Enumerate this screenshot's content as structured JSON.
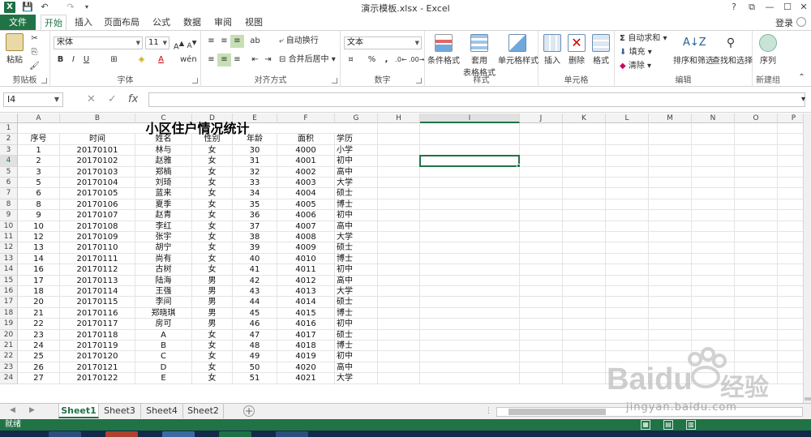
{
  "window": {
    "title": "演示模板.xlsx - Excel",
    "controls": [
      "?",
      "⧉",
      "—",
      "☐",
      "✕"
    ]
  },
  "ribbon_tabs": {
    "file": "文件",
    "tabs": [
      "开始",
      "插入",
      "页面布局",
      "公式",
      "数据",
      "审阅",
      "视图"
    ],
    "active": "开始",
    "login": "登录"
  },
  "ribbon": {
    "clipboard": {
      "label": "剪贴板",
      "paste": "粘贴"
    },
    "font": {
      "label": "字体",
      "font_name": "宋体",
      "font_size": "11"
    },
    "alignment": {
      "label": "对齐方式",
      "wrap": "自动换行",
      "merge": "合并后居中"
    },
    "number": {
      "label": "数字",
      "format": "文本"
    },
    "styles": {
      "label": "样式",
      "conditional": "条件格式",
      "table_1": "套用",
      "table_2": "表格格式",
      "cell_styles": "单元格样式"
    },
    "cells": {
      "label": "单元格",
      "insert": "插入",
      "delete": "删除",
      "format": "格式"
    },
    "editing": {
      "label": "编辑",
      "autosum": "自动求和",
      "fill": "填充",
      "clear": "清除",
      "sort": "排序和筛选",
      "find": "查找和选择"
    },
    "newgroup": {
      "label": "新建组",
      "sequence": "序列"
    }
  },
  "formula_bar": {
    "name_box": "I4",
    "cancel": "✕",
    "enter": "✓",
    "fx": "fx",
    "value": ""
  },
  "grid": {
    "columns": [
      "A",
      "B",
      "C",
      "D",
      "E",
      "F",
      "G",
      "H",
      "I",
      "J",
      "K",
      "L",
      "M",
      "N",
      "O",
      "P"
    ],
    "selected_column": "I",
    "selected_row": "4",
    "row_numbers": [
      "1",
      "2",
      "3",
      "4",
      "5",
      "6",
      "7",
      "8",
      "9",
      "10",
      "11",
      "12",
      "13",
      "14",
      "15",
      "16",
      "17",
      "18",
      "19",
      "20",
      "21",
      "22",
      "23",
      "24"
    ],
    "title": "小区住户情况统计",
    "headers": [
      "序号",
      "时间",
      "姓名",
      "性别",
      "年龄",
      "面积",
      "学历"
    ],
    "rows": [
      [
        "1",
        "20170101",
        "林与",
        "女",
        "30",
        "4000",
        "小学"
      ],
      [
        "2",
        "20170102",
        "赵雅",
        "女",
        "31",
        "4001",
        "初中"
      ],
      [
        "3",
        "20170103",
        "郑楠",
        "女",
        "32",
        "4002",
        "高中"
      ],
      [
        "5",
        "20170104",
        "刘琦",
        "女",
        "33",
        "4003",
        "大学"
      ],
      [
        "6",
        "20170105",
        "蓝来",
        "女",
        "34",
        "4004",
        "硕士"
      ],
      [
        "8",
        "20170106",
        "夏季",
        "女",
        "35",
        "4005",
        "博士"
      ],
      [
        "9",
        "20170107",
        "赵青",
        "女",
        "36",
        "4006",
        "初中"
      ],
      [
        "10",
        "20170108",
        "李红",
        "女",
        "37",
        "4007",
        "高中"
      ],
      [
        "12",
        "20170109",
        "张宇",
        "女",
        "38",
        "4008",
        "大学"
      ],
      [
        "13",
        "20170110",
        "胡宁",
        "女",
        "39",
        "4009",
        "硕士"
      ],
      [
        "14",
        "20170111",
        "尚有",
        "女",
        "40",
        "4010",
        "博士"
      ],
      [
        "16",
        "20170112",
        "古树",
        "女",
        "41",
        "4011",
        "初中"
      ],
      [
        "17",
        "20170113",
        "陆海",
        "男",
        "42",
        "4012",
        "高中"
      ],
      [
        "18",
        "20170114",
        "王强",
        "男",
        "43",
        "4013",
        "大学"
      ],
      [
        "20",
        "20170115",
        "李间",
        "男",
        "44",
        "4014",
        "硕士"
      ],
      [
        "21",
        "20170116",
        "郑晓琪",
        "男",
        "45",
        "4015",
        "博士"
      ],
      [
        "22",
        "20170117",
        "房可",
        "男",
        "46",
        "4016",
        "初中"
      ],
      [
        "23",
        "20170118",
        "A",
        "女",
        "47",
        "4017",
        "硕士"
      ],
      [
        "24",
        "20170119",
        "B",
        "女",
        "48",
        "4018",
        "博士"
      ],
      [
        "25",
        "20170120",
        "C",
        "女",
        "49",
        "4019",
        "初中"
      ],
      [
        "26",
        "20170121",
        "D",
        "女",
        "50",
        "4020",
        "高中"
      ],
      [
        "27",
        "20170122",
        "E",
        "女",
        "51",
        "4021",
        "大学"
      ]
    ]
  },
  "sheets": {
    "tabs": [
      "Sheet1",
      "Sheet3",
      "Sheet4",
      "Sheet2"
    ],
    "active": "Sheet1",
    "add": "+"
  },
  "status": {
    "text": "就绪"
  },
  "watermark": {
    "brand": "Baidu",
    "cn": "经验",
    "url": "jingyan.baidu.com"
  },
  "colors": {
    "accent": "#217346",
    "taskbar": "#12294a"
  }
}
